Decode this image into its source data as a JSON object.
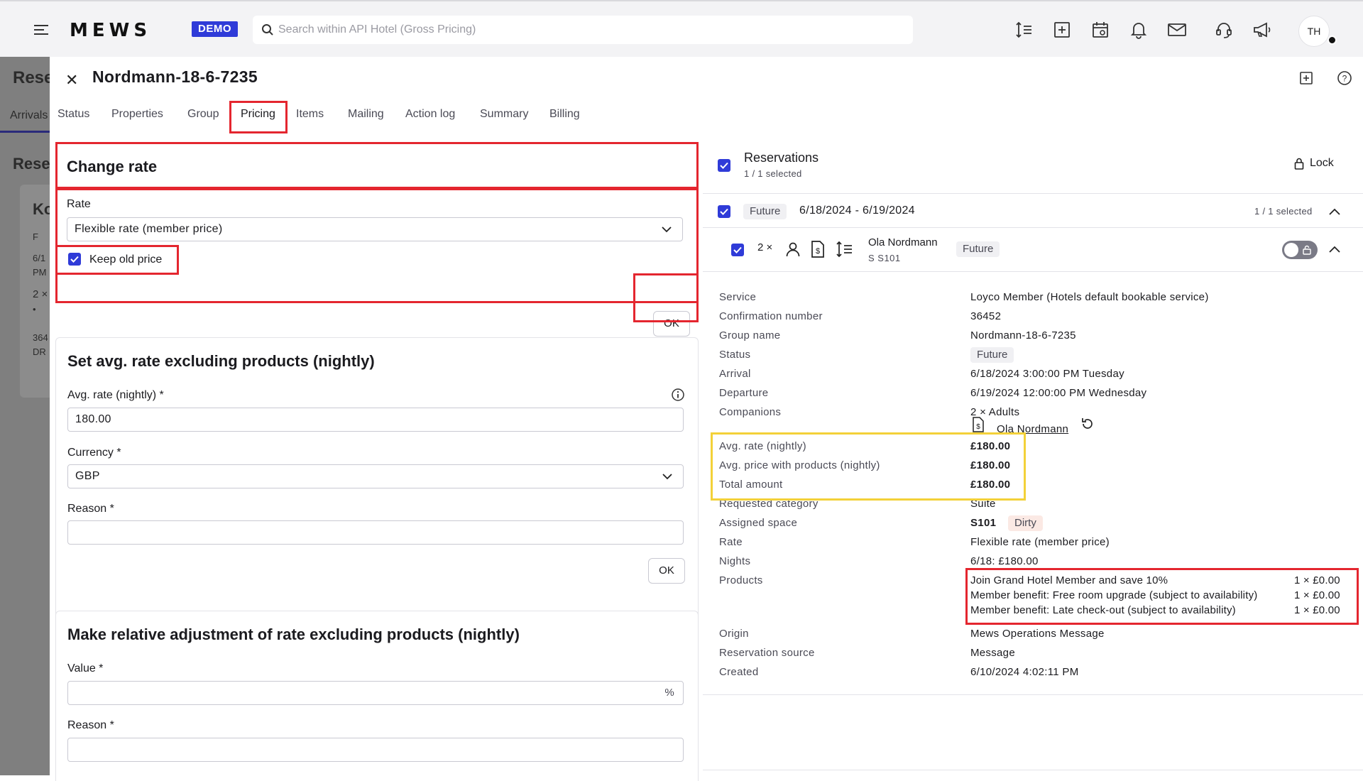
{
  "topbar": {
    "logo": "MEWS",
    "demo_badge": "DEMO",
    "search_placeholder": "Search within API Hotel (Gross Pricing)",
    "icons": [
      "sort-icon",
      "add-square-icon",
      "calendar-view-icon",
      "bell-icon",
      "mail-icon",
      "headset-icon",
      "megaphone-icon"
    ],
    "avatar_initials": "TH"
  },
  "background": {
    "title": "Rese",
    "tab": "Arrivals",
    "section": "Rese",
    "card_letter": "Ko",
    "lines": [
      "F",
      "6/1",
      "PM",
      "2 ×",
      "•",
      "364",
      "DR"
    ]
  },
  "panel": {
    "title": "Nordmann-18-6-7235",
    "tabs": [
      "Status",
      "Properties",
      "Group",
      "Pricing",
      "Items",
      "Mailing",
      "Action log",
      "Summary",
      "Billing"
    ],
    "active_tab": "Pricing"
  },
  "change_rate": {
    "title": "Change rate",
    "rate_label": "Rate",
    "rate_value": "Flexible rate (member price)",
    "keep_old_price_label": "Keep old price",
    "keep_old_price_checked": true,
    "ok_label": "OK"
  },
  "set_avg_rate": {
    "title": "Set avg. rate excluding products (nightly)",
    "avg_rate_label": "Avg. rate (nightly) *",
    "avg_rate_value": "180.00",
    "currency_label": "Currency *",
    "currency_value": "GBP",
    "reason_label": "Reason *",
    "reason_value": "",
    "ok_label": "OK"
  },
  "relative_adjustment": {
    "title": "Make relative adjustment of rate excluding products (nightly)",
    "value_label": "Value *",
    "value_suffix": "%",
    "reason_label": "Reason *"
  },
  "reservations": {
    "title": "Reservations",
    "selected": "1 / 1 selected",
    "lock_label": "Lock",
    "group": {
      "status": "Future",
      "dates": "6/18/2024 - 6/19/2024",
      "selected": "1 / 1 selected"
    },
    "item": {
      "count": "2 ×",
      "guest_name": "Ola Nordmann",
      "space": "S S101",
      "status": "Future"
    },
    "details": {
      "service_label": "Service",
      "service_value": "Loyco Member (Hotels default bookable service)",
      "confirmation_label": "Confirmation number",
      "confirmation_value": "36452",
      "group_name_label": "Group name",
      "group_name_value": "Nordmann-18-6-7235",
      "status_label": "Status",
      "status_value": "Future",
      "arrival_label": "Arrival",
      "arrival_value": "6/18/2024 3:00:00 PM Tuesday",
      "departure_label": "Departure",
      "departure_value": "6/19/2024 12:00:00 PM Wednesday",
      "companions_label": "Companions",
      "companions_value": "2 × Adults",
      "companion_name": "Ola Nordmann",
      "avg_rate_label": "Avg. rate (nightly)",
      "avg_rate_value": "£180.00",
      "avg_price_products_label": "Avg. price with products (nightly)",
      "avg_price_products_value": "£180.00",
      "total_amount_label": "Total amount",
      "total_amount_value": "£180.00",
      "requested_category_label": "Requested category",
      "requested_category_value": "Suite",
      "assigned_space_label": "Assigned space",
      "assigned_space_value": "S101",
      "assigned_space_state": "Dirty",
      "rate_label": "Rate",
      "rate_value": "Flexible rate (member price)",
      "nights_label": "Nights",
      "nights_value": "6/18: £180.00",
      "products_label": "Products",
      "products": [
        {
          "name": "Join Grand Hotel Member and save 10%",
          "qty": "1 × £0.00"
        },
        {
          "name": "Member benefit: Free room upgrade (subject to availability)",
          "qty": "1 × £0.00"
        },
        {
          "name": "Member benefit: Late check-out (subject to availability)",
          "qty": "1 × £0.00"
        }
      ],
      "origin_label": "Origin",
      "origin_value": "Mews Operations Message",
      "reservation_source_label": "Reservation source",
      "reservation_source_value": "Message",
      "created_label": "Created",
      "created_value": "6/10/2024 4:02:11 PM"
    }
  },
  "colors": {
    "accent": "#2f3bd8",
    "highlight_red": "#e4262f",
    "highlight_yellow": "#f3d139"
  }
}
